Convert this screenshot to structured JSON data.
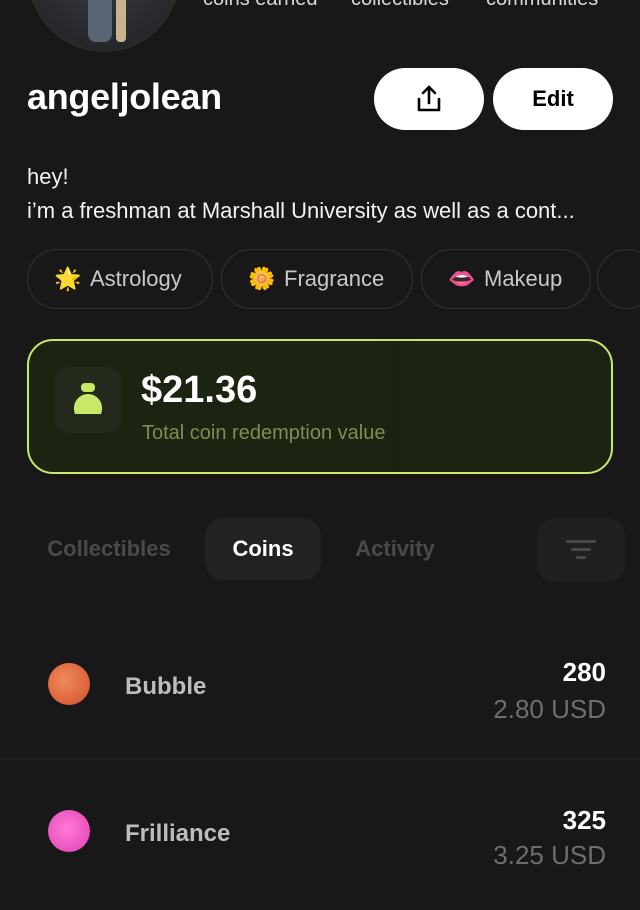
{
  "profile": {
    "username": "angeljolean",
    "bio_line1": "hey!",
    "bio_line2": "i’m a freshman at Marshall University as well as a cont...",
    "stats": [
      {
        "label": "coins earned"
      },
      {
        "label": "collectibles"
      },
      {
        "label": "communities"
      }
    ],
    "edit_label": "Edit",
    "share_icon": "share-upload-icon"
  },
  "interests": [
    {
      "emoji": "🌟",
      "label": "Astrology"
    },
    {
      "emoji": "🌼",
      "label": "Fragrance"
    },
    {
      "emoji": "👄",
      "label": "Makeup"
    }
  ],
  "balance": {
    "amount": "$21.36",
    "label": "Total coin redemption value",
    "icon": "money-bag-icon",
    "accent": "#c9e86a"
  },
  "tabs": [
    {
      "label": "Collectibles"
    },
    {
      "label": "Coins"
    },
    {
      "label": "Activity"
    }
  ],
  "active_tab": "Coins",
  "coins": [
    {
      "name": "Bubble",
      "count": "280",
      "usd": "2.80 USD",
      "color": "#e0643a"
    },
    {
      "name": "Frilliance",
      "count": "325",
      "usd": "3.25 USD",
      "color": "#f060c8"
    }
  ]
}
